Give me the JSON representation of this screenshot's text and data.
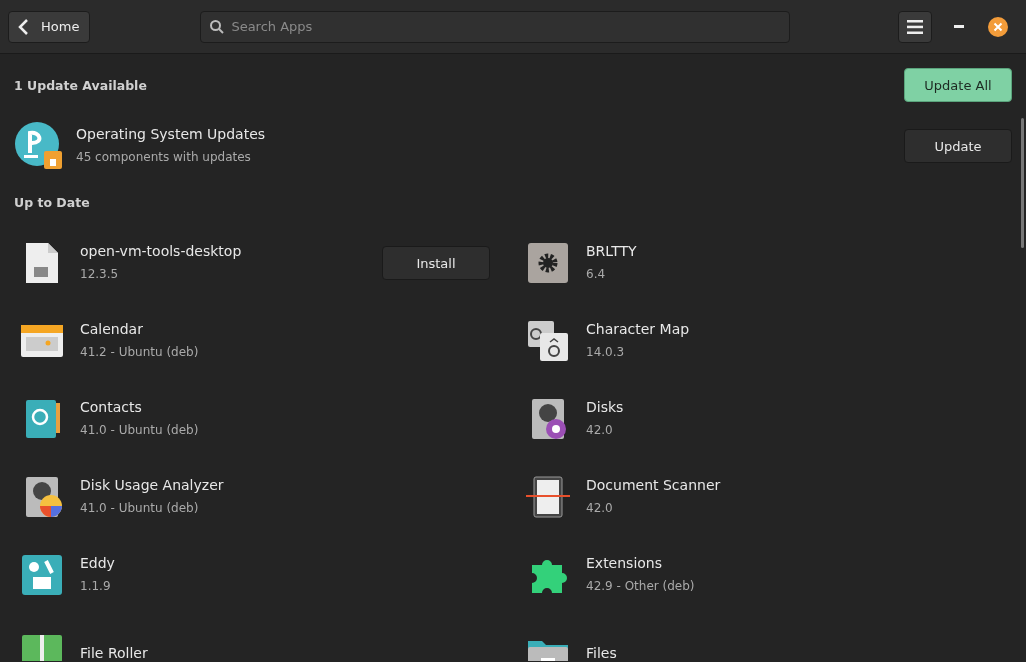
{
  "header": {
    "back_button": "Home",
    "search": {
      "placeholder": "Search Apps"
    }
  },
  "updates": {
    "title": "1 Update Available",
    "update_all_button": "Update All",
    "items": [
      {
        "name": "Operating System Updates",
        "detail": "45 components with updates",
        "button": "Update"
      }
    ]
  },
  "up_to_date": {
    "title": "Up to Date",
    "apps": [
      {
        "name": "open-vm-tools-desktop",
        "version": "12.3.5",
        "button": "Install"
      },
      {
        "name": "BRLTTY",
        "version": "6.4"
      },
      {
        "name": "Calendar",
        "version": "41.2 - Ubuntu (deb)"
      },
      {
        "name": "Character Map",
        "version": "14.0.3"
      },
      {
        "name": "Contacts",
        "version": "41.0 - Ubuntu (deb)"
      },
      {
        "name": "Disks",
        "version": "42.0"
      },
      {
        "name": "Disk Usage Analyzer",
        "version": "41.0 - Ubuntu (deb)"
      },
      {
        "name": "Document Scanner",
        "version": "42.0"
      },
      {
        "name": "Eddy",
        "version": "1.1.9"
      },
      {
        "name": "Extensions",
        "version": "42.9 - Other (deb)"
      },
      {
        "name": "File Roller"
      },
      {
        "name": "Files"
      }
    ]
  }
}
